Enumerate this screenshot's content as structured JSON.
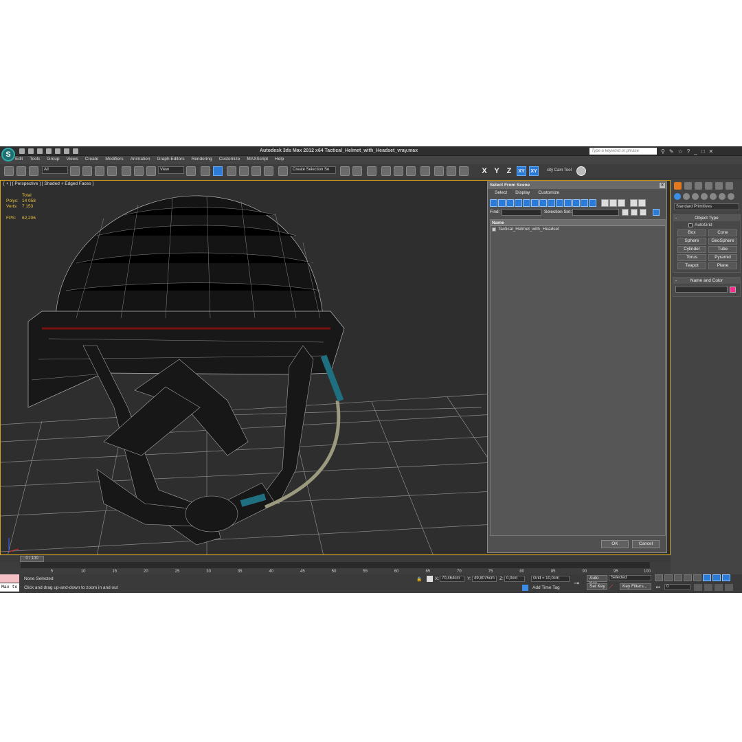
{
  "window": {
    "logo_glyph": "S",
    "title": "Autodesk 3ds Max  2012 x64     Tactical_Helmet_with_Headset_vray.max",
    "search_placeholder": "Type a keyword or phrase"
  },
  "menu": [
    "Edit",
    "Tools",
    "Group",
    "Views",
    "Create",
    "Modifiers",
    "Animation",
    "Graph Editors",
    "Rendering",
    "Customize",
    "MAXScript",
    "Help"
  ],
  "toolbar": {
    "selection_filter": "All",
    "reference_coord": "View",
    "selection_set": "Create Selection Se",
    "axis_x": "X",
    "axis_y": "Y",
    "axis_z": "Z",
    "axis_xy": "XY",
    "axis_xy2": "XY",
    "cam_tool": "city Cam Tool"
  },
  "viewport": {
    "label": "[ + ] [ Perspective ] [ Shaded + Edged Faces ]",
    "stats": {
      "total_label": "Total",
      "polys_label": "Polys:",
      "polys_value": "14 058",
      "verts_label": "Verts:",
      "verts_value": "7 153",
      "fps_label": "FPS:",
      "fps_value": "62,206"
    }
  },
  "select_dialog": {
    "title": "Select From Scene",
    "menu": [
      "Select",
      "Display",
      "Customize"
    ],
    "find_label": "Find:",
    "selection_set_label": "Selection Set:",
    "column_name": "Name",
    "items": [
      "Tactical_Helmet_with_Headset"
    ],
    "ok": "OK",
    "cancel": "Cancel"
  },
  "command_panel": {
    "category": "Standard Primitives",
    "object_type_title": "Object Type",
    "rollout_marker": "-",
    "autogrid": "AutoGrid",
    "primitives": [
      "Box",
      "Cone",
      "Sphere",
      "GeoSphere",
      "Cylinder",
      "Tube",
      "Torus",
      "Pyramid",
      "Teapot",
      "Plane"
    ],
    "name_color_title": "Name and Color",
    "object_color": "#ff2d8f"
  },
  "timeline": {
    "slider": "0 / 100",
    "ticks": [
      "0",
      "5",
      "10",
      "15",
      "20",
      "25",
      "30",
      "35",
      "40",
      "45",
      "50",
      "55",
      "60",
      "65",
      "70",
      "75",
      "80",
      "85",
      "90",
      "95",
      "100"
    ]
  },
  "status": {
    "maxscript": "Max to",
    "selection": "None Selected",
    "prompt": "Click and drag up-and-down to zoom in and out",
    "x_label": "X:",
    "x_value": "70,464cm",
    "y_label": "Y:",
    "y_value": "49,8075cm",
    "z_label": "Z:",
    "z_value": "0,0cm",
    "grid": "Grid = 10,0cm",
    "add_time_tag": "Add Time Tag",
    "auto_key": "Auto Key",
    "set_key": "Set Key",
    "key_mode": "Selected",
    "key_filters": "Key Filters...",
    "frame": "0"
  },
  "colors": {
    "viewport_border": "#d4a31a",
    "stats_text": "#e8c23d",
    "active_blue": "#2c7bd6"
  }
}
